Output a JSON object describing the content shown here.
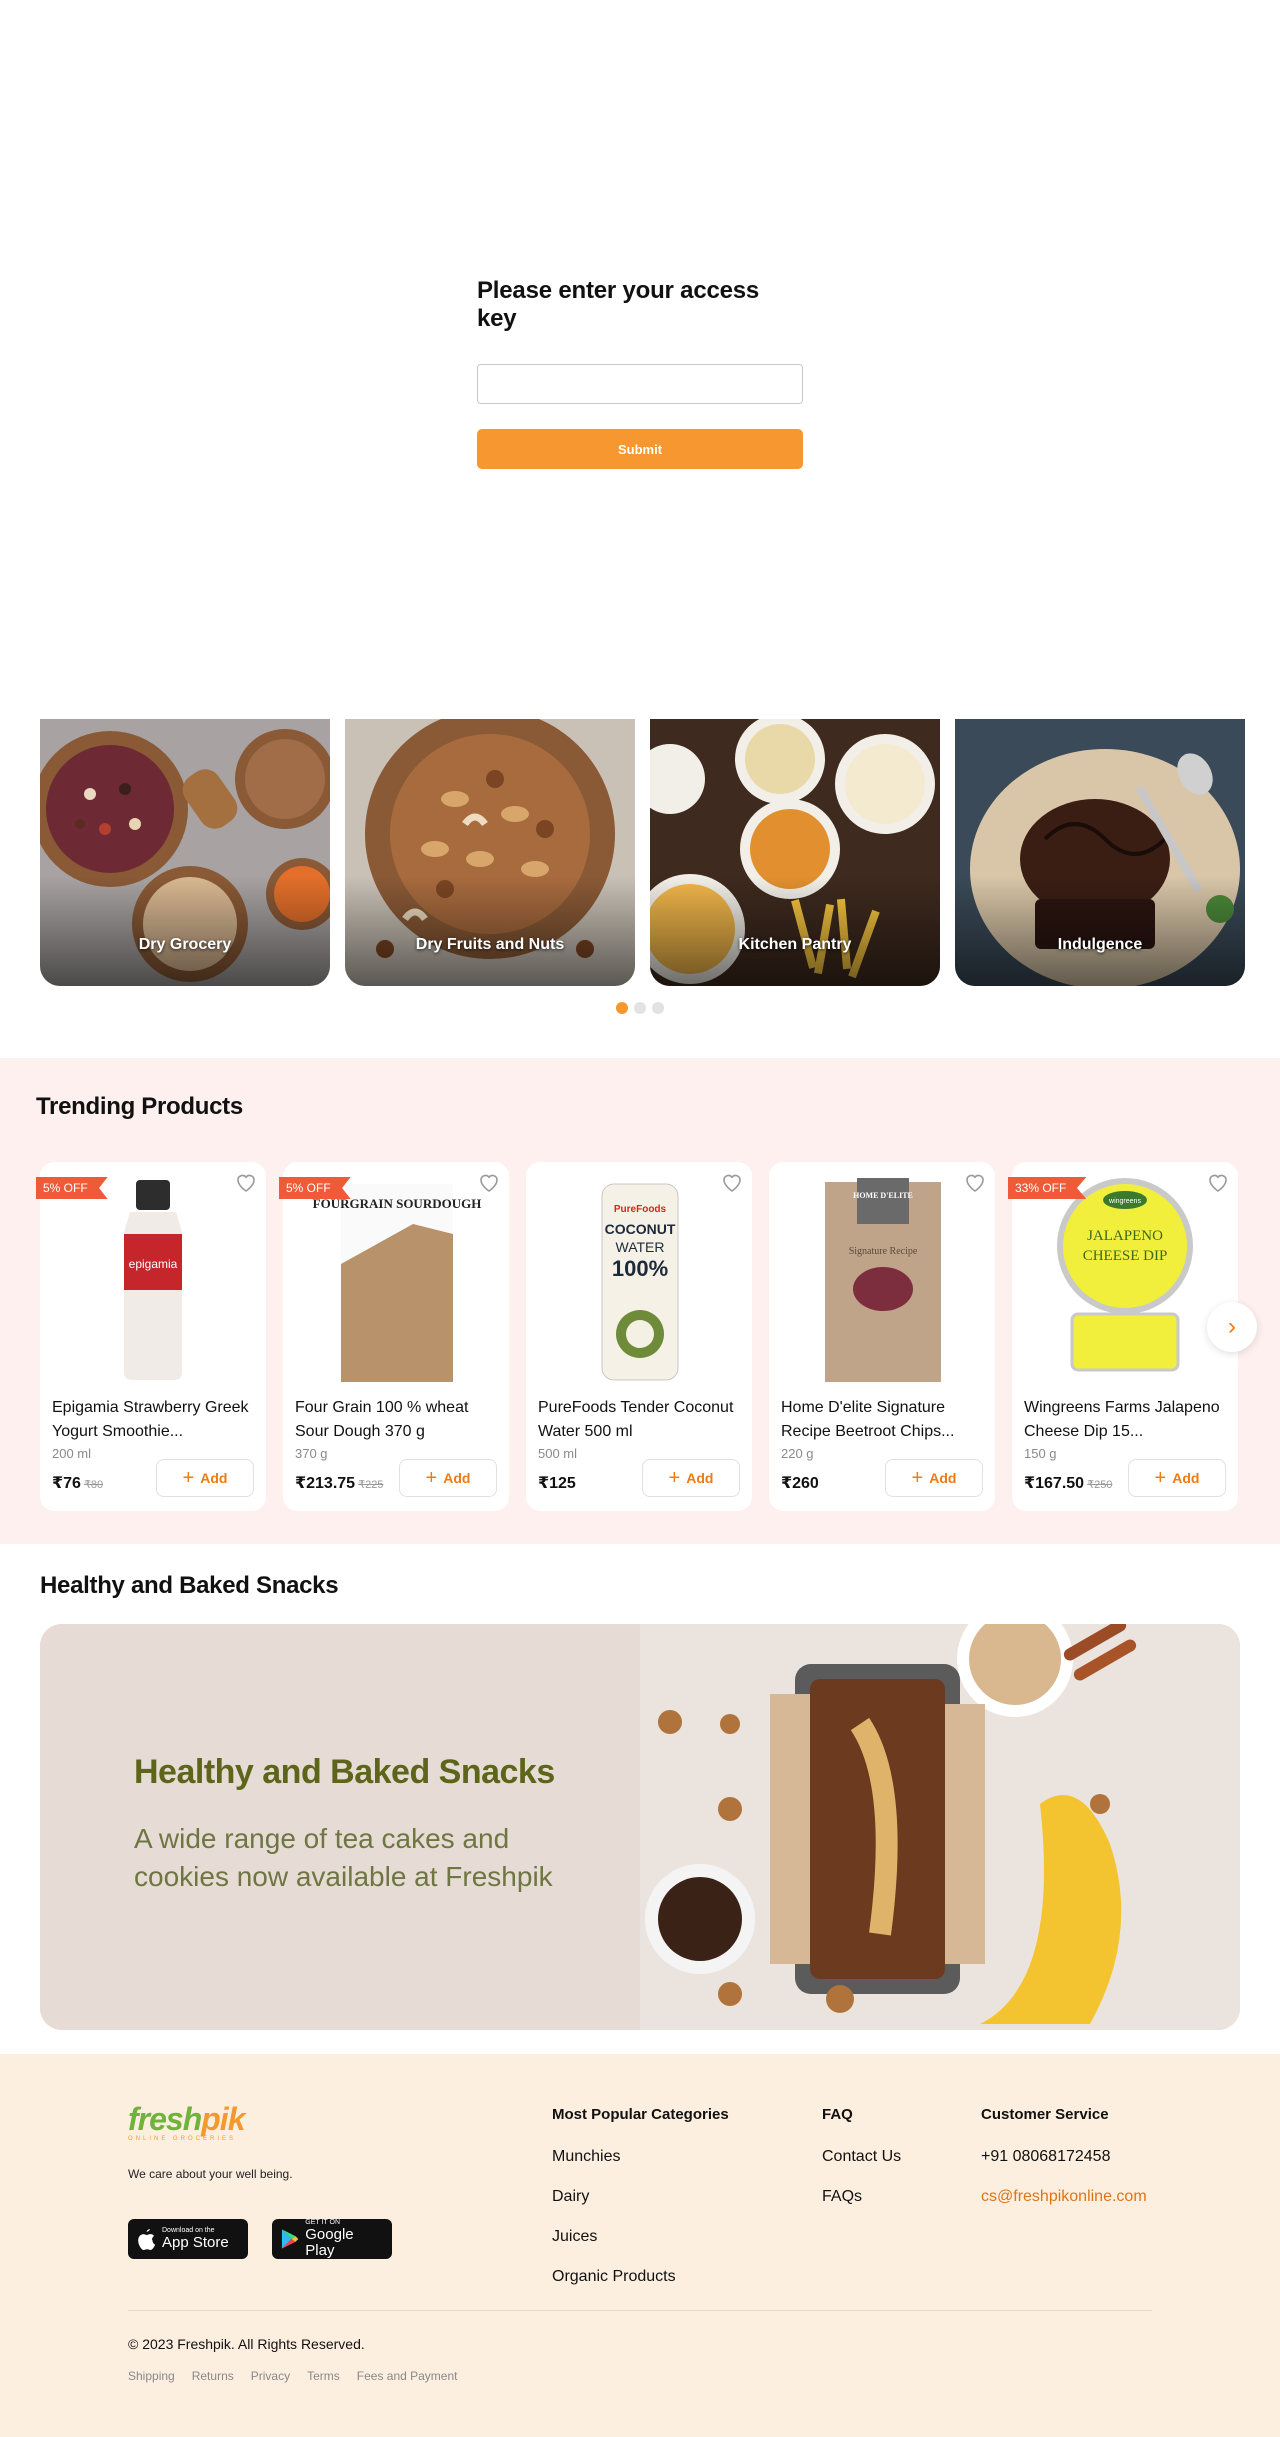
{
  "access": {
    "title": "Please enter your access key",
    "input_value": "",
    "input_placeholder": "",
    "submit_label": "Submit"
  },
  "categories": [
    {
      "label": "Dry Grocery"
    },
    {
      "label": "Dry Fruits and Nuts"
    },
    {
      "label": "Kitchen Pantry"
    },
    {
      "label": "Indulgence"
    }
  ],
  "carousel": {
    "total_dots": 3,
    "active_dot": 1
  },
  "trending": {
    "title": "Trending Products",
    "add_label": "Add",
    "products": [
      {
        "badge": "5% OFF",
        "name": "Epigamia Strawberry Greek Yogurt Smoothie...",
        "qty": "200 ml",
        "price": "₹76",
        "mrp": "₹80"
      },
      {
        "badge": "5% OFF",
        "name": "Four Grain 100 % wheat Sour Dough 370 g",
        "qty": "370 g",
        "price": "₹213.75",
        "mrp": "₹225"
      },
      {
        "badge": "",
        "name": "PureFoods Tender Coconut Water 500 ml",
        "qty": "500 ml",
        "price": "₹125",
        "mrp": ""
      },
      {
        "badge": "",
        "name": "Home D'elite Signature Recipe Beetroot Chips...",
        "qty": "220 g",
        "price": "₹260",
        "mrp": ""
      },
      {
        "badge": "33% OFF",
        "name": "Wingreens Farms Jalapeno Cheese Dip 15...",
        "qty": "150 g",
        "price": "₹167.50",
        "mrp": "₹250"
      }
    ],
    "packaging_text": {
      "yogurt": "epigamia",
      "bread": "FOURGRAIN SOURDOUGH",
      "can_brand": "PureFoods",
      "can_line1": "COCONUT",
      "can_line2": "WATER",
      "can_line3": "100%",
      "chips_brand": "HOME D'ELITE",
      "chips_label": "Signature Recipe",
      "dip_brand": "wingreens",
      "dip_line1": "JALAPENO",
      "dip_line2": "CHEESE DIP"
    }
  },
  "healthy": {
    "section_title": "Healthy and Baked Snacks",
    "banner_title": "Healthy and Baked Snacks",
    "banner_text": "A wide range of tea cakes and cookies now available at Freshpik"
  },
  "footer": {
    "logo_part1": "fresh",
    "logo_part2": "pik",
    "logo_sub": "ONLINE GROCERIES",
    "tagline": "We care about your well being.",
    "appstore_small": "Download on the",
    "appstore_big": "App Store",
    "play_small": "GET IT ON",
    "play_big": "Google Play",
    "popular": {
      "title": "Most Popular Categories",
      "items": [
        "Munchies",
        "Dairy",
        "Juices",
        "Organic Products"
      ]
    },
    "faq": {
      "title": "FAQ",
      "items": [
        "Contact Us",
        "FAQs"
      ]
    },
    "service": {
      "title": "Customer Service",
      "phone": "+91 08068172458",
      "email": "cs@freshpikonline.com"
    },
    "copyright": "© 2023 Freshpik. All Rights Reserved.",
    "links": [
      "Shipping",
      "Returns",
      "Privacy",
      "Terms",
      "Fees and Payment"
    ]
  },
  "colors": {
    "accent": "#f7972f",
    "badge": "#ef5b38",
    "trending_bg": "#fdf0ef",
    "footer_bg": "#fdefe0",
    "banner_title": "#5c6519"
  },
  "icons": [
    "heart-icon",
    "plus-icon",
    "chevron-right-icon",
    "apple-icon",
    "google-play-icon"
  ]
}
